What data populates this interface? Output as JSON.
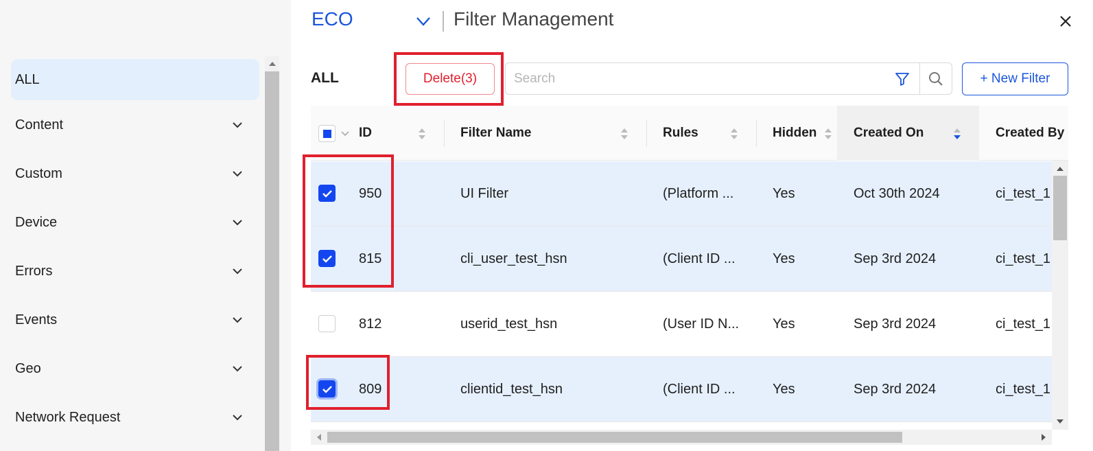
{
  "colors": {
    "accent": "#1a56db",
    "checkbox": "#1446f0",
    "danger": "#e0202d",
    "selected_row": "#e6f0fd",
    "sidebar_active": "#e3effd"
  },
  "sidebar": {
    "items": [
      {
        "label": "ALL",
        "active": true
      },
      {
        "label": "Content"
      },
      {
        "label": "Custom"
      },
      {
        "label": "Device"
      },
      {
        "label": "Errors"
      },
      {
        "label": "Events"
      },
      {
        "label": "Geo"
      },
      {
        "label": "Network Request"
      }
    ]
  },
  "header": {
    "project": "ECO",
    "title": "Filter Management",
    "close_icon": "close-icon"
  },
  "toolbar": {
    "section_label": "ALL",
    "delete_label": "Delete(3)",
    "search_placeholder": "Search",
    "search_value": "",
    "new_filter_label": "+ New Filter"
  },
  "table": {
    "columns": [
      {
        "key": "id",
        "label": "ID"
      },
      {
        "key": "name",
        "label": "Filter Name"
      },
      {
        "key": "rules",
        "label": "Rules"
      },
      {
        "key": "hidden",
        "label": "Hidden"
      },
      {
        "key": "created_on",
        "label": "Created On",
        "sort": "descending"
      },
      {
        "key": "created_by",
        "label": "Created By"
      }
    ],
    "header_checkbox": "indeterminate",
    "rows": [
      {
        "checked": true,
        "id": "950",
        "name": "UI Filter",
        "rules": "(Platform ...",
        "hidden": "Yes",
        "created_on": "Oct 30th 2024",
        "created_by": "ci_test_1"
      },
      {
        "checked": true,
        "id": "815",
        "name": "cli_user_test_hsn",
        "rules": "(Client ID ...",
        "hidden": "Yes",
        "created_on": "Sep 3rd 2024",
        "created_by": "ci_test_1"
      },
      {
        "checked": false,
        "id": "812",
        "name": "userid_test_hsn",
        "rules": "(User ID N...",
        "hidden": "Yes",
        "created_on": "Sep 3rd 2024",
        "created_by": "ci_test_1"
      },
      {
        "checked": true,
        "id": "809",
        "name": "clientid_test_hsn",
        "rules": "(Client ID ...",
        "hidden": "Yes",
        "created_on": "Sep 3rd 2024",
        "created_by": "ci_test_1"
      }
    ]
  }
}
